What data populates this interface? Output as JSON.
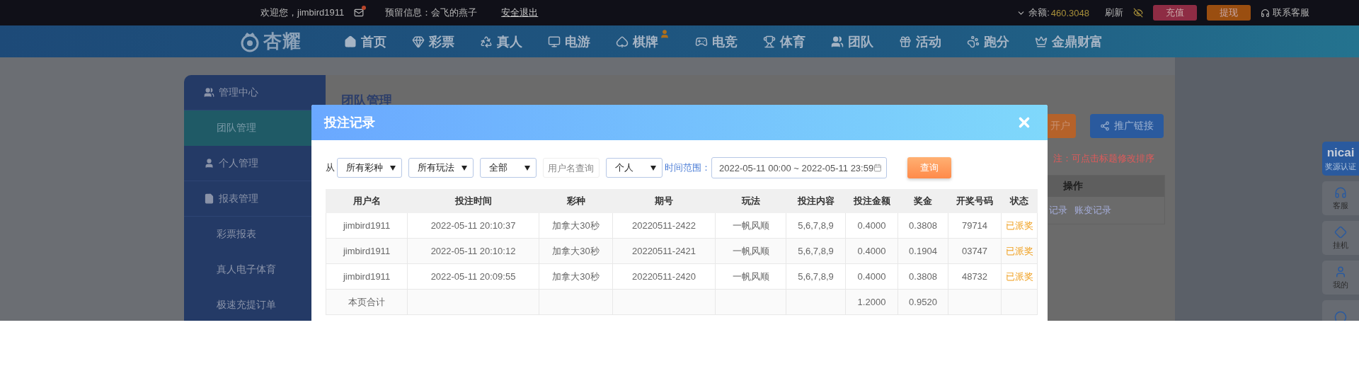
{
  "top_bar": {
    "greeting": "欢迎您，jimbird1911",
    "reserved_info": "预留信息：会飞的燕子",
    "logout": "安全退出",
    "balance_label": "余额:",
    "balance": "460.3048",
    "refresh": "刷新",
    "deposit": "充值",
    "withdraw": "提现",
    "support": "联系客服"
  },
  "nav": {
    "logo": "杏耀",
    "items": [
      {
        "label": "首页",
        "badge": false
      },
      {
        "label": "彩票",
        "badge": false
      },
      {
        "label": "真人",
        "badge": false
      },
      {
        "label": "电游",
        "badge": false
      },
      {
        "label": "棋牌",
        "badge": true
      },
      {
        "label": "电竞",
        "badge": false
      },
      {
        "label": "体育",
        "badge": false
      },
      {
        "label": "团队",
        "badge": false
      },
      {
        "label": "活动",
        "badge": false
      },
      {
        "label": "跑分",
        "badge": false
      },
      {
        "label": "金鼎财富",
        "badge": false
      }
    ]
  },
  "sidebar": {
    "items": [
      {
        "label": "管理中心",
        "kind": "group",
        "selected": false
      },
      {
        "label": "团队管理",
        "kind": "link",
        "selected": true
      },
      {
        "label": "个人管理",
        "kind": "group",
        "selected": false
      },
      {
        "label": "报表管理",
        "kind": "group",
        "selected": false
      },
      {
        "label": "彩票报表",
        "kind": "link",
        "selected": false
      },
      {
        "label": "真人电子体育",
        "kind": "link",
        "selected": false
      },
      {
        "label": "极速充提订单",
        "kind": "link",
        "selected": false
      }
    ]
  },
  "page": {
    "title": "团队管理",
    "buttons": [
      {
        "label": "开户",
        "kind": "orange"
      },
      {
        "label": "推广链接",
        "kind": "blue"
      }
    ],
    "note": "注：可点击标题修改排序",
    "table": {
      "columns": [
        "操作"
      ],
      "links": [
        "记录",
        "账变记录"
      ]
    }
  },
  "side_tools": [
    {
      "kind": "nicai",
      "logo": "nicai",
      "label": "奖源认证"
    },
    {
      "kind": "headset",
      "label": "客服"
    },
    {
      "kind": "diamond",
      "label": "挂机"
    },
    {
      "kind": "user",
      "label": "我的"
    },
    {
      "kind": "chat"
    }
  ],
  "modal": {
    "title": "投注记录",
    "filters": {
      "from_label": "从",
      "selects": [
        {
          "value": "所有彩种"
        },
        {
          "value": "所有玩法"
        },
        {
          "value": "全部"
        }
      ],
      "username": {
        "placeholder": "用户名查询"
      },
      "scope": {
        "value": "个人"
      },
      "time_label": "时间范围：",
      "time_range": "2022-05-11 00:00 ~ 2022-05-11 23:59",
      "search": "查询"
    },
    "table": {
      "columns": [
        "用户名",
        "投注时间",
        "彩种",
        "期号",
        "玩法",
        "投注内容",
        "投注金额",
        "奖金",
        "开奖号码",
        "状态"
      ],
      "rows": [
        [
          "jimbird1911",
          "2022-05-11 20:10:37",
          "加拿大30秒",
          "20220511-2422",
          "一帆风顺",
          "5,6,7,8,9",
          "0.4000",
          "0.3808",
          "79714",
          "已派奖"
        ],
        [
          "jimbird1911",
          "2022-05-11 20:10:12",
          "加拿大30秒",
          "20220511-2421",
          "一帆风顺",
          "5,6,7,8,9",
          "0.4000",
          "0.1904",
          "03747",
          "已派奖"
        ],
        [
          "jimbird1911",
          "2022-05-11 20:09:55",
          "加拿大30秒",
          "20220511-2420",
          "一帆风顺",
          "5,6,7,8,9",
          "0.4000",
          "0.3808",
          "48732",
          "已派奖"
        ]
      ],
      "total_row": {
        "label": "本页合计",
        "amount": "1.2000",
        "prize": "0.9520"
      }
    }
  }
}
